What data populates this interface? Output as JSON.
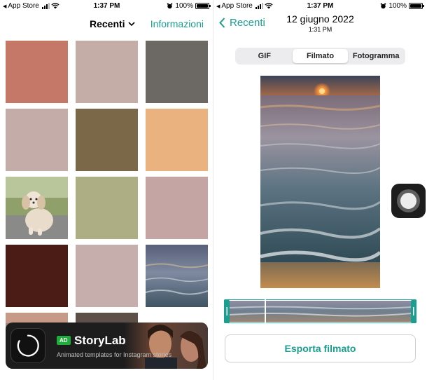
{
  "status_bar": {
    "back_app": "App Store",
    "time": "1:37 PM",
    "battery": "100%"
  },
  "left": {
    "title": "Recenti",
    "info_link": "Informazioni",
    "tile_colors": [
      "#c57868",
      "#c4aca7",
      "#6c6863",
      "#c4aca9",
      "#7b6848",
      "#eab27f",
      "photo-dog",
      "#aeae84",
      "#c4a5a3",
      "#4a1c15",
      "#c6aeac",
      "photo-sea",
      "photo-sunset",
      "#5c5048",
      ""
    ],
    "ad": {
      "badge": "AD",
      "title": "StoryLab",
      "subtitle": "Animated templates for Instagram stories"
    }
  },
  "right": {
    "back_label": "Recenti",
    "date": "12 giugno 2022",
    "time": "1:31 PM",
    "segments": [
      "GIF",
      "Filmato",
      "Fotogramma"
    ],
    "active_segment": "Filmato",
    "export_label": "Esporta filmato",
    "accent": "#1a9e8f"
  }
}
